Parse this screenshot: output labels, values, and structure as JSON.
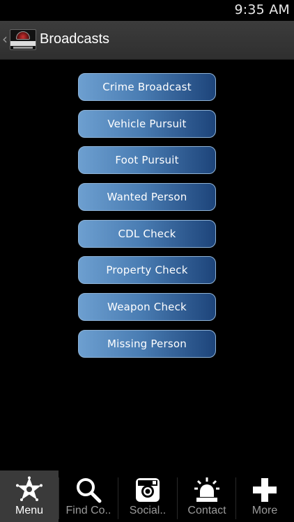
{
  "status_bar": {
    "time": "9:35 AM"
  },
  "header": {
    "title": "Broadcasts",
    "back_icon": "chevron-left-icon",
    "logo_icon": "pocket-brainbook-logo"
  },
  "menu": {
    "items": [
      {
        "label": "Crime Broadcast"
      },
      {
        "label": "Vehicle Pursuit"
      },
      {
        "label": "Foot Pursuit"
      },
      {
        "label": "Wanted Person"
      },
      {
        "label": "CDL Check"
      },
      {
        "label": "Property Check"
      },
      {
        "label": "Weapon Check"
      },
      {
        "label": "Missing Person"
      }
    ]
  },
  "bottom_nav": {
    "items": [
      {
        "label": "Menu",
        "icon": "badge-star-icon",
        "active": true
      },
      {
        "label": "Find Co..",
        "icon": "search-icon",
        "active": false
      },
      {
        "label": "Social..",
        "icon": "instagram-icon",
        "active": false
      },
      {
        "label": "Contact",
        "icon": "siren-icon",
        "active": false
      },
      {
        "label": "More",
        "icon": "plus-icon",
        "active": false
      }
    ]
  },
  "colors": {
    "background": "#000000",
    "action_bar": "#333333",
    "button_light": "#6d9fd0",
    "button_dark": "#1d447a",
    "button_border": "#8fb3d6",
    "nav_active_bg": "#3a3a3a",
    "nav_inactive_text": "#9a9a9a"
  }
}
